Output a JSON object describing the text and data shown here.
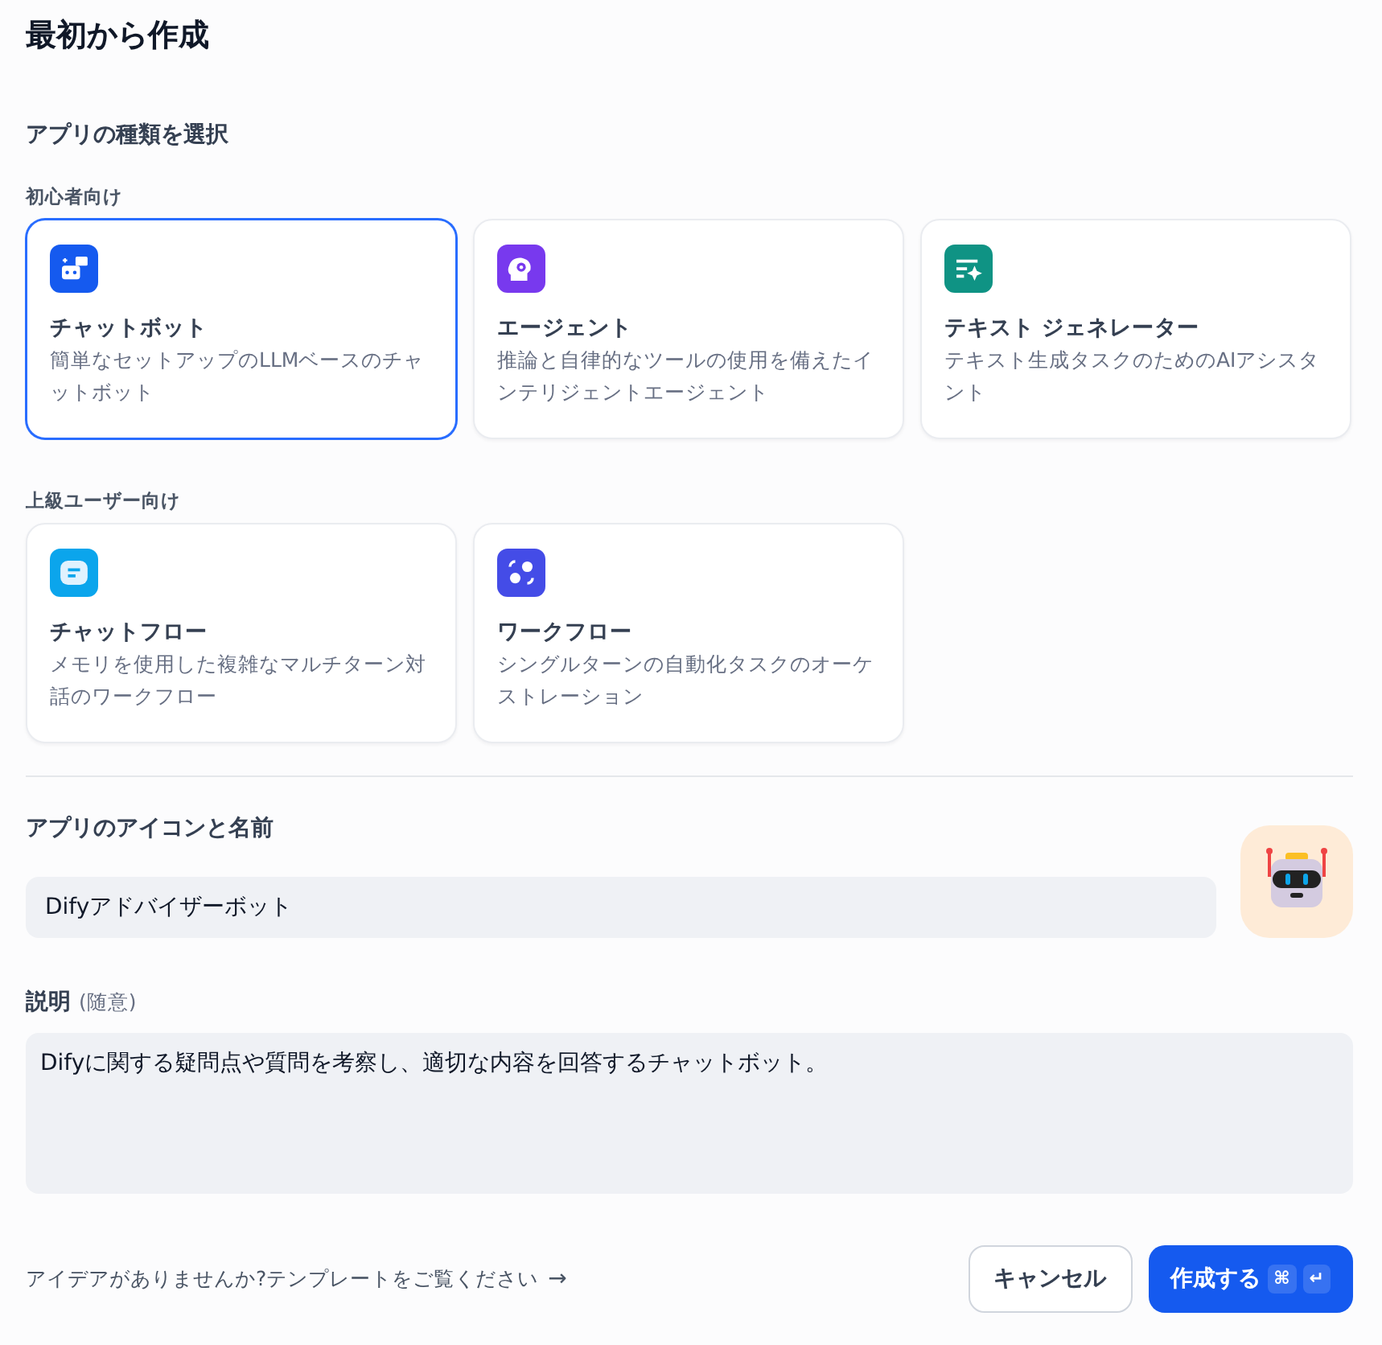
{
  "title": "最初から作成",
  "section_label": "アプリの種類を選択",
  "groups": [
    {
      "label": "初心者向け",
      "cards": [
        {
          "kind": "chatbot",
          "title": "チャットボット",
          "description": "簡単なセットアップのLLMベースのチャットボット",
          "selected": true
        },
        {
          "kind": "agent",
          "title": "エージェント",
          "description": "推論と自律的なツールの使用を備えたインテリジェントエージェント",
          "selected": false
        },
        {
          "kind": "text-generator",
          "title": "テキスト ジェネレーター",
          "description": "テキスト生成タスクのためのAIアシスタント",
          "selected": false
        }
      ]
    },
    {
      "label": "上級ユーザー向け",
      "cards": [
        {
          "kind": "chatflow",
          "title": "チャットフロー",
          "description": "メモリを使用した複雑なマルチターン対話のワークフロー",
          "selected": false
        },
        {
          "kind": "workflow",
          "title": "ワークフロー",
          "description": "シングルターンの自動化タスクのオーケストレーション",
          "selected": false
        }
      ]
    }
  ],
  "name_field": {
    "label": "アプリのアイコンと名前",
    "value": "Difyアドバイザーボット"
  },
  "description_field": {
    "label": "説明",
    "optional": "(随意)",
    "value": "Difyに関する疑問点や質問を考察し、適切な内容を回答するチャットボット。"
  },
  "template_link": "アイデアがありませんか?テンプレートをご覧ください",
  "template_arrow": "→",
  "buttons": {
    "cancel": "キャンセル",
    "create": "作成する",
    "keys": [
      "⌘",
      "↵"
    ]
  }
}
